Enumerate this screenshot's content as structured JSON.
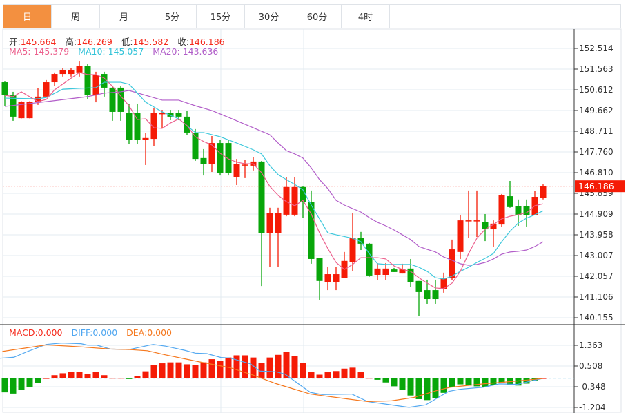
{
  "tabs": [
    {
      "label": "日",
      "active": true
    },
    {
      "label": "周"
    },
    {
      "label": "月"
    },
    {
      "label": "5分"
    },
    {
      "label": "15分"
    },
    {
      "label": "30分"
    },
    {
      "label": "60分"
    },
    {
      "label": "4时"
    }
  ],
  "ohlc_legend": {
    "open_label": "开:",
    "open": "145.664",
    "high_label": "高:",
    "high": "146.269",
    "low_label": "低:",
    "low": "145.582",
    "close_label": "收:",
    "close": "146.186"
  },
  "ma_legend": {
    "ma5": "MA5: 145.379",
    "ma10": "MA10: 145.057",
    "ma20": "MA20: 143.636"
  },
  "macd_legend": {
    "macd": "MACD:0.000",
    "diff": "DIFF:0.000",
    "dea": "DEA:0.000"
  },
  "colors": {
    "up": "#f51b06",
    "down": "#08a60a",
    "tab_active": "#f39040",
    "ma5": "#ec5f8c",
    "ma10": "#3ec8dc",
    "ma20": "#b25ec9",
    "diff": "#52a8f0",
    "dea": "#f5781e"
  },
  "chart_data": [
    {
      "type": "candlestick",
      "title": "Daily K-line",
      "last_price": "146.186",
      "y_ticks": [
        "152.514",
        "151.563",
        "150.612",
        "149.662",
        "148.711",
        "147.760",
        "146.810",
        "145.859",
        "144.909",
        "143.958",
        "143.007",
        "142.057",
        "141.106",
        "140.155"
      ],
      "ylim": [
        140.155,
        152.514
      ],
      "candles_ohlc": [
        [
          150.96,
          150.99,
          149.88,
          150.39
        ],
        [
          150.39,
          150.52,
          149.19,
          149.38
        ],
        [
          149.31,
          150.09,
          149.3,
          150.07
        ],
        [
          149.31,
          150.09,
          149.3,
          150.07
        ],
        [
          150.07,
          150.68,
          149.92,
          150.3
        ],
        [
          150.3,
          151.06,
          150.3,
          150.96
        ],
        [
          150.96,
          151.41,
          150.8,
          151.34
        ],
        [
          151.34,
          151.6,
          151.22,
          151.53
        ],
        [
          151.34,
          151.6,
          151.22,
          151.53
        ],
        [
          151.41,
          151.91,
          151.22,
          151.72
        ],
        [
          151.72,
          151.79,
          150.17,
          150.36
        ],
        [
          150.36,
          151.44,
          150.04,
          151.31
        ],
        [
          151.34,
          151.44,
          150.3,
          150.71
        ],
        [
          150.71,
          150.74,
          149.19,
          149.6
        ],
        [
          150.71,
          150.77,
          149.19,
          149.6
        ],
        [
          149.54,
          149.98,
          148.11,
          148.33
        ],
        [
          149.54,
          149.98,
          148.11,
          148.33
        ],
        [
          148.33,
          148.62,
          147.16,
          148.4
        ],
        [
          148.36,
          149.76,
          148.02,
          149.54
        ],
        [
          149.52,
          149.69,
          148.87,
          149.54
        ],
        [
          149.54,
          149.69,
          149.22,
          149.38
        ],
        [
          149.54,
          149.69,
          149.22,
          149.38
        ],
        [
          149.38,
          149.66,
          148.55,
          148.65
        ],
        [
          148.62,
          148.81,
          147.35,
          147.44
        ],
        [
          147.48,
          147.89,
          146.68,
          147.22
        ],
        [
          147.19,
          148.49,
          146.84,
          148.17
        ],
        [
          148.17,
          148.33,
          146.68,
          146.81
        ],
        [
          148.17,
          148.33,
          146.68,
          146.81
        ],
        [
          146.62,
          147.44,
          146.24,
          147.22
        ],
        [
          147.16,
          147.38,
          146.56,
          147.18
        ],
        [
          147.13,
          147.51,
          146.91,
          147.32
        ],
        [
          147.32,
          147.35,
          141.61,
          144.05
        ],
        [
          144.05,
          145.2,
          142.5,
          144.97
        ],
        [
          144.05,
          145.2,
          142.5,
          144.97
        ],
        [
          144.88,
          146.59,
          144.81,
          146.15
        ],
        [
          144.88,
          146.59,
          144.81,
          146.15
        ],
        [
          146.15,
          146.18,
          144.72,
          145.45
        ],
        [
          145.45,
          145.99,
          142.63,
          142.85
        ],
        [
          142.88,
          142.91,
          140.98,
          141.84
        ],
        [
          141.8,
          142.47,
          141.42,
          142.15
        ],
        [
          141.8,
          142.47,
          141.42,
          142.15
        ],
        [
          141.99,
          143.17,
          141.99,
          142.76
        ],
        [
          142.72,
          144.97,
          142.28,
          143.83
        ],
        [
          143.83,
          144.09,
          143.26,
          143.55
        ],
        [
          143.55,
          143.58,
          142.03,
          142.09
        ],
        [
          142.12,
          142.66,
          141.87,
          142.41
        ],
        [
          142.12,
          142.66,
          141.87,
          142.41
        ],
        [
          142.37,
          142.44,
          142.25,
          142.25
        ],
        [
          142.18,
          142.63,
          142.18,
          142.37
        ],
        [
          142.41,
          142.85,
          141.55,
          141.8
        ],
        [
          141.84,
          141.84,
          140.25,
          141.33
        ],
        [
          141.42,
          141.9,
          140.79,
          141.01
        ],
        [
          141.42,
          141.9,
          140.79,
          141.01
        ],
        [
          141.46,
          142.22,
          141.3,
          141.96
        ],
        [
          141.96,
          143.74,
          141.87,
          143.29
        ],
        [
          143.17,
          144.85,
          142.85,
          144.62
        ],
        [
          144.61,
          145.99,
          143.8,
          144.62
        ],
        [
          144.61,
          145.99,
          143.86,
          144.62
        ],
        [
          144.53,
          144.91,
          143.67,
          144.21
        ],
        [
          144.21,
          144.62,
          143.42,
          144.47
        ],
        [
          144.43,
          145.83,
          144.31,
          145.77
        ],
        [
          145.73,
          146.43,
          145.2,
          145.23
        ],
        [
          145.26,
          145.58,
          144.37,
          144.85
        ],
        [
          145.26,
          145.58,
          144.34,
          144.85
        ],
        [
          144.85,
          145.96,
          144.85,
          145.7
        ],
        [
          145.664,
          146.269,
          145.582,
          146.186
        ]
      ],
      "ma5": [
        [
          0,
          150.36
        ],
        [
          1,
          150.3
        ],
        [
          2,
          150.52
        ],
        [
          4,
          150.07
        ],
        [
          5,
          150.17
        ],
        [
          6,
          150.61
        ],
        [
          9,
          151.41
        ],
        [
          10,
          151.31
        ],
        [
          11,
          151.31
        ],
        [
          12,
          151.15
        ],
        [
          13,
          150.77
        ],
        [
          15,
          149.88
        ],
        [
          16,
          149.25
        ],
        [
          17,
          149.28
        ],
        [
          18,
          148.87
        ],
        [
          19,
          148.84
        ],
        [
          20,
          149.09
        ],
        [
          21,
          149.28
        ],
        [
          22,
          148.97
        ],
        [
          23,
          148.46
        ],
        [
          24,
          148.24
        ],
        [
          25,
          148.08
        ],
        [
          26,
          147.7
        ],
        [
          27,
          147.44
        ],
        [
          28,
          147.29
        ],
        [
          29,
          147.22
        ],
        [
          30,
          147.22
        ],
        [
          31,
          146.81
        ],
        [
          32,
          146.18
        ],
        [
          33,
          145.77
        ],
        [
          34,
          145.48
        ],
        [
          35,
          145.29
        ],
        [
          36,
          145.54
        ],
        [
          37,
          144.91
        ],
        [
          38,
          144.05
        ],
        [
          39,
          143.33
        ],
        [
          40,
          142.69
        ],
        [
          41,
          142.37
        ],
        [
          42,
          142.6
        ],
        [
          43,
          142.91
        ],
        [
          44,
          142.91
        ],
        [
          45,
          142.91
        ],
        [
          46,
          142.85
        ],
        [
          47,
          142.53
        ],
        [
          48,
          142.37
        ],
        [
          49,
          142.28
        ],
        [
          50,
          141.99
        ],
        [
          51,
          141.74
        ],
        [
          52,
          141.52
        ],
        [
          53,
          141.49
        ],
        [
          54,
          141.74
        ],
        [
          55,
          142.28
        ],
        [
          56,
          143.1
        ],
        [
          57,
          143.8
        ],
        [
          58,
          144.21
        ],
        [
          59,
          144.43
        ],
        [
          60,
          144.69
        ],
        [
          61,
          144.81
        ],
        [
          62,
          144.88
        ],
        [
          63,
          144.97
        ],
        [
          64,
          145.29
        ],
        [
          65,
          145.379
        ]
      ],
      "ma10": [
        [
          0,
          150.23
        ],
        [
          4,
          150.2
        ],
        [
          5,
          150.26
        ],
        [
          7,
          150.64
        ],
        [
          9,
          150.68
        ],
        [
          11,
          150.71
        ],
        [
          12,
          150.96
        ],
        [
          14,
          150.96
        ],
        [
          15,
          150.87
        ],
        [
          17,
          150.05
        ],
        [
          19,
          149.6
        ],
        [
          21,
          149.28
        ],
        [
          23,
          148.65
        ],
        [
          24,
          148.65
        ],
        [
          26,
          148.46
        ],
        [
          28,
          148.17
        ],
        [
          30,
          147.86
        ],
        [
          31,
          147.67
        ],
        [
          32,
          147.13
        ],
        [
          33,
          146.72
        ],
        [
          34,
          146.49
        ],
        [
          35,
          146.27
        ],
        [
          36,
          146.02
        ],
        [
          37,
          145.32
        ],
        [
          38,
          144.69
        ],
        [
          39,
          144.05
        ],
        [
          40,
          143.96
        ],
        [
          42,
          143.8
        ],
        [
          43,
          143.64
        ],
        [
          44,
          143.1
        ],
        [
          45,
          142.63
        ],
        [
          46,
          142.6
        ],
        [
          48,
          142.6
        ],
        [
          49,
          142.6
        ],
        [
          50,
          142.47
        ],
        [
          51,
          142.28
        ],
        [
          52,
          141.99
        ],
        [
          53,
          141.93
        ],
        [
          54,
          142.06
        ],
        [
          55,
          142.28
        ],
        [
          56,
          142.47
        ],
        [
          57,
          142.69
        ],
        [
          58,
          142.88
        ],
        [
          59,
          143.1
        ],
        [
          60,
          143.64
        ],
        [
          61,
          144.12
        ],
        [
          62,
          144.5
        ],
        [
          63,
          144.72
        ],
        [
          64,
          144.88
        ],
        [
          65,
          145.057
        ]
      ],
      "ma20": [
        [
          0,
          149.85
        ],
        [
          5,
          150.07
        ],
        [
          10,
          150.3
        ],
        [
          12,
          150.46
        ],
        [
          14,
          150.52
        ],
        [
          15,
          150.58
        ],
        [
          17,
          150.36
        ],
        [
          19,
          150.14
        ],
        [
          21,
          150.14
        ],
        [
          23,
          149.88
        ],
        [
          25,
          149.66
        ],
        [
          27,
          149.35
        ],
        [
          29,
          149.03
        ],
        [
          31,
          148.71
        ],
        [
          32,
          148.55
        ],
        [
          33,
          148.17
        ],
        [
          34,
          147.82
        ],
        [
          35,
          147.67
        ],
        [
          36,
          147.48
        ],
        [
          37,
          147.03
        ],
        [
          38,
          146.49
        ],
        [
          39,
          146.08
        ],
        [
          40,
          145.54
        ],
        [
          41,
          145.32
        ],
        [
          42,
          145.16
        ],
        [
          43,
          145.0
        ],
        [
          44,
          144.75
        ],
        [
          45,
          144.53
        ],
        [
          46,
          144.37
        ],
        [
          47,
          144.18
        ],
        [
          48,
          143.96
        ],
        [
          49,
          143.74
        ],
        [
          50,
          143.42
        ],
        [
          51,
          143.29
        ],
        [
          52,
          143.17
        ],
        [
          53,
          142.94
        ],
        [
          54,
          142.79
        ],
        [
          55,
          142.63
        ],
        [
          56,
          142.56
        ],
        [
          57,
          142.6
        ],
        [
          58,
          142.69
        ],
        [
          59,
          142.85
        ],
        [
          60,
          143.07
        ],
        [
          61,
          143.17
        ],
        [
          62,
          143.2
        ],
        [
          63,
          143.26
        ],
        [
          64,
          143.42
        ],
        [
          65,
          143.636
        ]
      ]
    },
    {
      "type": "bar",
      "title": "MACD",
      "y_ticks": [
        "1.363",
        "0.508",
        "-0.348",
        "-1.204"
      ],
      "ylim": [
        -1.204,
        1.363
      ],
      "macd_hist": [
        -0.58,
        -0.63,
        -0.48,
        -0.36,
        -0.19,
        0,
        0.13,
        0.21,
        0.26,
        0.27,
        0.17,
        0.27,
        0.13,
        0.01,
        0.01,
        -0.03,
        0.09,
        0.29,
        0.54,
        0.62,
        0.66,
        0.66,
        0.58,
        0.54,
        0.66,
        0.79,
        0.73,
        0.86,
        0.95,
        0.95,
        0.86,
        0.64,
        0.86,
        0.97,
        1.09,
        0.93,
        0.63,
        0.25,
        0.15,
        0.25,
        0.3,
        0.4,
        0.44,
        0.25,
        0.01,
        -0.06,
        -0.17,
        -0.33,
        -0.49,
        -0.71,
        -0.86,
        -0.9,
        -0.82,
        -0.6,
        -0.37,
        -0.25,
        -0.3,
        -0.33,
        -0.36,
        -0.28,
        -0.2,
        -0.27,
        -0.3,
        -0.22,
        -0.09,
        0
      ],
      "diff": [
        [
          -0.6,
          0.83
        ],
        [
          1.1,
          0.87
        ],
        [
          2.75,
          1.11
        ],
        [
          5,
          1.4
        ],
        [
          6.9,
          1.46
        ],
        [
          9.2,
          1.43
        ],
        [
          10,
          1.37
        ],
        [
          11.1,
          1.37
        ],
        [
          12.75,
          1.21
        ],
        [
          15,
          1.19
        ],
        [
          17.9,
          1.4
        ],
        [
          19.4,
          1.33
        ],
        [
          21.7,
          1.16
        ],
        [
          23,
          1.04
        ],
        [
          24.4,
          1.02
        ],
        [
          26.1,
          0.86
        ],
        [
          27.2,
          0.84
        ],
        [
          29.7,
          0.59
        ],
        [
          30.8,
          0.3
        ],
        [
          32.75,
          0.27
        ],
        [
          33.8,
          0.18
        ],
        [
          36.9,
          -0.58
        ],
        [
          38.3,
          -0.67
        ],
        [
          41.9,
          -0.65
        ],
        [
          43.8,
          -0.96
        ],
        [
          46.7,
          -1.1
        ],
        [
          48.8,
          -1.2
        ],
        [
          50.8,
          -1.1
        ],
        [
          53.6,
          -0.54
        ],
        [
          55,
          -0.45
        ],
        [
          57.75,
          -0.37
        ],
        [
          59.7,
          -0.23
        ],
        [
          61.9,
          -0.25
        ],
        [
          63.8,
          -0.09
        ],
        [
          64.9,
          -0.01
        ]
      ],
      "dea": [
        [
          -0.3,
          1.11
        ],
        [
          5,
          1.38
        ],
        [
          9.2,
          1.3
        ],
        [
          12.75,
          1.21
        ],
        [
          15,
          1.19
        ],
        [
          17.2,
          1.14
        ],
        [
          19.4,
          0.97
        ],
        [
          23.8,
          0.66
        ],
        [
          27.2,
          0.44
        ],
        [
          30,
          0.13
        ],
        [
          32.75,
          -0.22
        ],
        [
          36.9,
          -0.65
        ],
        [
          41.1,
          -0.84
        ],
        [
          43.8,
          -0.96
        ],
        [
          46.7,
          -0.93
        ],
        [
          49.4,
          -0.79
        ],
        [
          52.2,
          -0.5
        ],
        [
          53.8,
          -0.37
        ],
        [
          57.75,
          -0.23
        ],
        [
          61.9,
          -0.11
        ],
        [
          64.9,
          -0.01
        ]
      ]
    }
  ]
}
